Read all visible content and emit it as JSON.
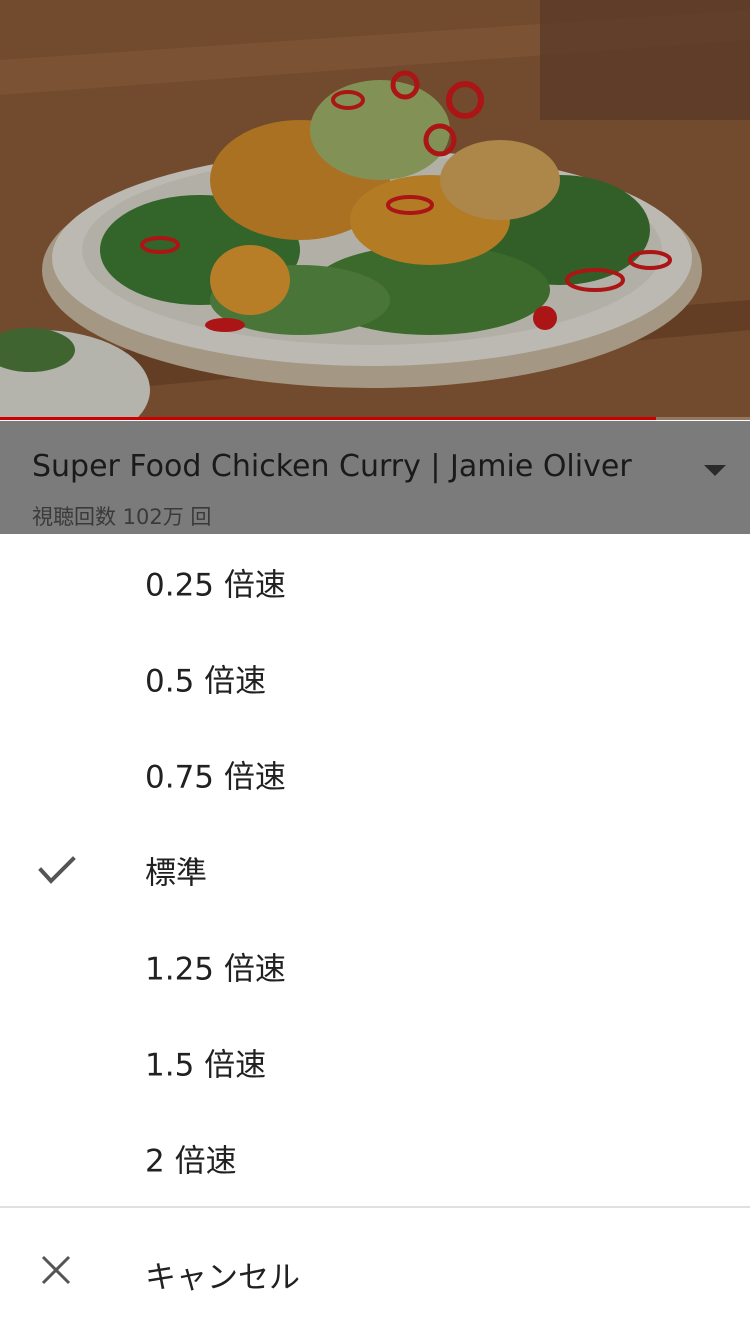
{
  "video": {
    "progress": 0.874
  },
  "info": {
    "title": "Super Food Chicken Curry | Jamie Oliver",
    "views": "視聴回数 102万 回"
  },
  "speed_menu": {
    "options": [
      {
        "label": "0.25 倍速",
        "selected": false
      },
      {
        "label": "0.5 倍速",
        "selected": false
      },
      {
        "label": "0.75 倍速",
        "selected": false
      },
      {
        "label": "標準",
        "selected": true
      },
      {
        "label": "1.25 倍速",
        "selected": false
      },
      {
        "label": "1.5 倍速",
        "selected": false
      },
      {
        "label": "2 倍速",
        "selected": false
      }
    ],
    "cancel_label": "キャンセル"
  },
  "colors": {
    "progress": "#cc0000",
    "text": "#212121",
    "icon": "#555555"
  }
}
